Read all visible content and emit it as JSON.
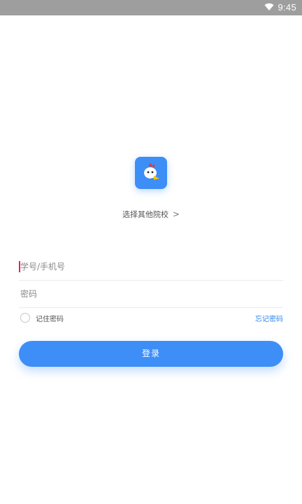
{
  "status_bar": {
    "time": "9:45",
    "icons": [
      "wifi-icon"
    ]
  },
  "app": {
    "logo_icon": "school-mascot-icon",
    "brand_color": "#3d8ef7"
  },
  "school_selector": {
    "label": "选择其他院校",
    "chevron": ">"
  },
  "form": {
    "account": {
      "placeholder": "学号/手机号",
      "value": ""
    },
    "password": {
      "placeholder": "密码",
      "value": ""
    },
    "remember_label": "记住密码",
    "remember_checked": false,
    "forgot_label": "忘记密码",
    "login_label": "登录"
  },
  "colors": {
    "accent": "#3d8ef7",
    "link": "#2f86f0",
    "caret": "#e0245e"
  }
}
